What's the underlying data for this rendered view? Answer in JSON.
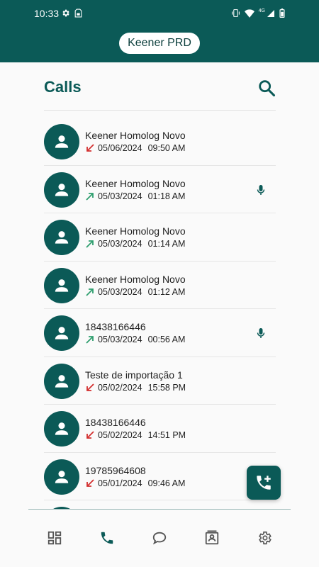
{
  "status_bar": {
    "time": "10:33",
    "left_icons": [
      "settings-icon",
      "sim-icon"
    ],
    "right_icons": [
      "vibrate-icon",
      "wifi-icon",
      "network-4g-icon",
      "battery-icon"
    ],
    "network_label": "4G"
  },
  "app_bar": {
    "tenant_name": "Keener PRD"
  },
  "page": {
    "title": "Calls",
    "search_icon": "search-icon"
  },
  "colors": {
    "primary": "#0b5a57",
    "incoming": "#d32f2f",
    "outgoing": "#2e9e6e"
  },
  "calls": [
    {
      "name": "Keener Homolog Novo",
      "date": "05/06/2024",
      "time": "09:50 AM",
      "direction": "incoming",
      "has_recording": false
    },
    {
      "name": "Keener Homolog Novo",
      "date": "05/03/2024",
      "time": "01:18 AM",
      "direction": "outgoing",
      "has_recording": true
    },
    {
      "name": "Keener Homolog Novo",
      "date": "05/03/2024",
      "time": "01:14 AM",
      "direction": "outgoing",
      "has_recording": false
    },
    {
      "name": "Keener Homolog Novo",
      "date": "05/03/2024",
      "time": "01:12 AM",
      "direction": "outgoing",
      "has_recording": false
    },
    {
      "name": "18438166446",
      "date": "05/03/2024",
      "time": "00:56 AM",
      "direction": "outgoing",
      "has_recording": true
    },
    {
      "name": "Teste de importação 1",
      "date": "05/02/2024",
      "time": "15:58 PM",
      "direction": "incoming",
      "has_recording": false
    },
    {
      "name": "18438166446",
      "date": "05/02/2024",
      "time": "14:51 PM",
      "direction": "incoming",
      "has_recording": false
    },
    {
      "name": "19785964608",
      "date": "05/01/2024",
      "time": "09:46 AM",
      "direction": "incoming",
      "has_recording": false
    },
    {
      "name": "",
      "date": "",
      "time": "",
      "direction": "incoming",
      "has_recording": false
    }
  ],
  "fab": {
    "icon": "add-call-icon"
  },
  "bottom_nav": [
    {
      "icon": "dashboard-icon",
      "active": false
    },
    {
      "icon": "phone-icon",
      "active": true
    },
    {
      "icon": "chat-icon",
      "active": false
    },
    {
      "icon": "contacts-icon",
      "active": false
    },
    {
      "icon": "settings-icon",
      "active": false
    }
  ]
}
